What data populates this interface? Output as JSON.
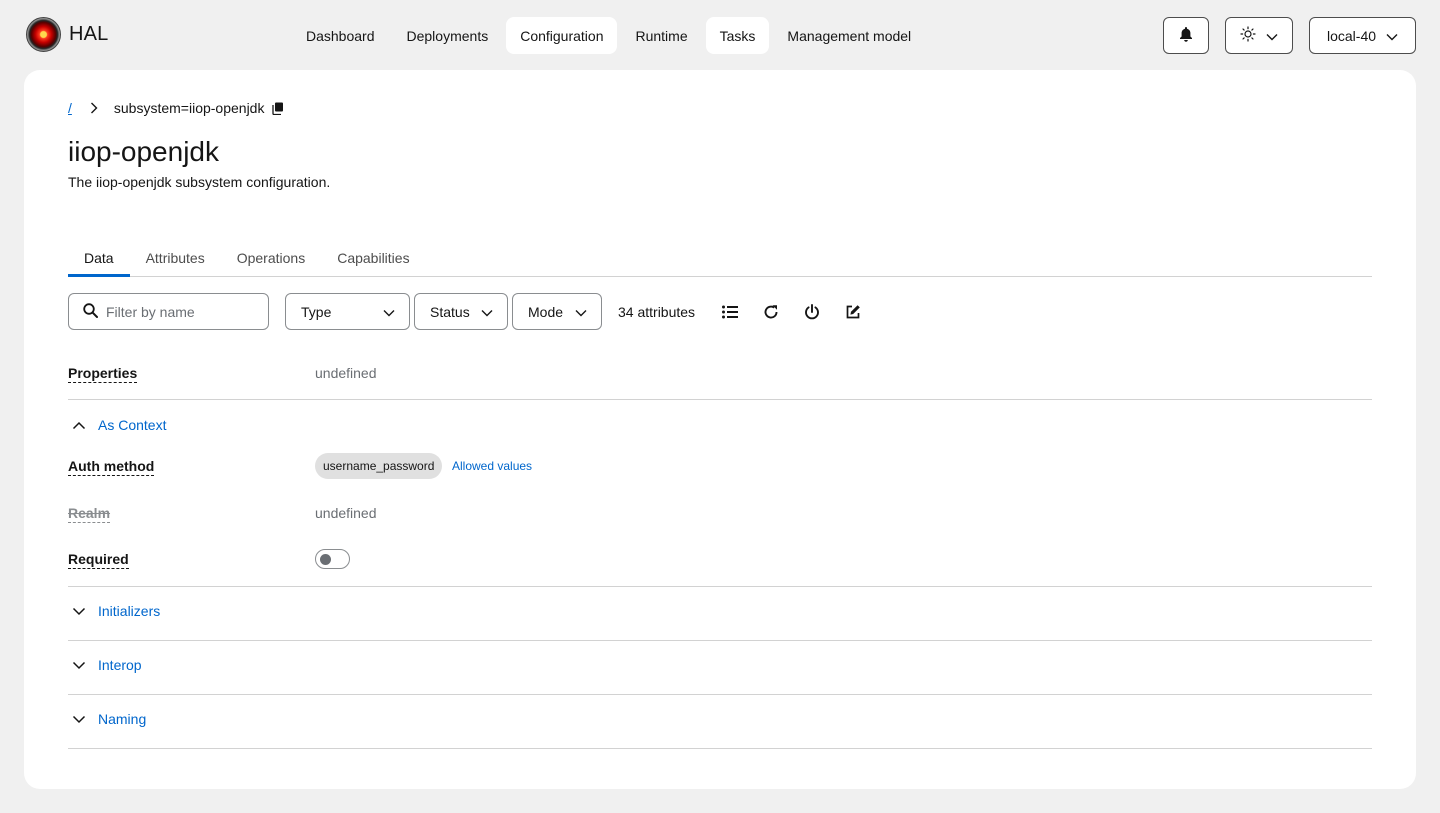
{
  "brand": {
    "name": "HAL"
  },
  "nav": {
    "items": [
      {
        "label": "Dashboard",
        "active": false
      },
      {
        "label": "Deployments",
        "active": false
      },
      {
        "label": "Configuration",
        "active": true
      },
      {
        "label": "Runtime",
        "active": false
      },
      {
        "label": "Tasks",
        "active": true
      },
      {
        "label": "Management model",
        "active": false
      }
    ]
  },
  "header": {
    "notification_icon": "bell-icon",
    "theme_icon": "sun-icon",
    "server": "local-40"
  },
  "breadcrumb": {
    "root": "/",
    "current": "subsystem=iiop-openjdk"
  },
  "page": {
    "title": "iiop-openjdk",
    "description": "The iiop-openjdk subsystem configuration."
  },
  "tabs": [
    {
      "label": "Data",
      "active": true
    },
    {
      "label": "Attributes",
      "active": false
    },
    {
      "label": "Operations",
      "active": false
    },
    {
      "label": "Capabilities",
      "active": false
    }
  ],
  "toolbar": {
    "search_placeholder": "Filter by name",
    "filters": {
      "type": "Type",
      "status": "Status",
      "mode": "Mode"
    },
    "count": "34 attributes"
  },
  "attributes": {
    "properties": {
      "label": "Properties",
      "value": "undefined"
    },
    "as_context": {
      "title": "As Context",
      "auth_method": {
        "label": "Auth method",
        "value": "username_password",
        "link": "Allowed values"
      },
      "realm": {
        "label": "Realm",
        "value": "undefined"
      },
      "required": {
        "label": "Required",
        "value": false
      }
    },
    "sections": [
      "Initializers",
      "Interop",
      "Naming"
    ]
  },
  "colors": {
    "link": "#0066cc",
    "accent": "#0066cc",
    "background": "#f0f0f0"
  }
}
